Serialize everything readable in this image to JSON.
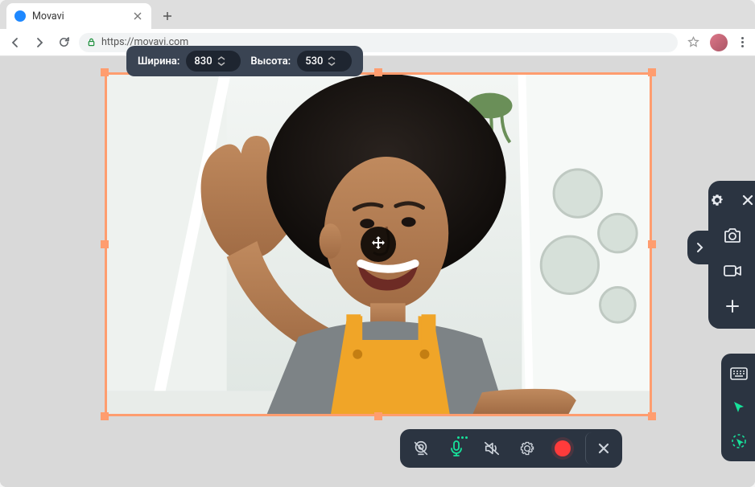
{
  "browser": {
    "tab_title": "Movavi",
    "url": "https://movavi.com"
  },
  "capture": {
    "width_label": "Ширина:",
    "height_label": "Высота:",
    "width_value": "830",
    "height_value": "530"
  },
  "icons": {
    "settings": "gear-icon",
    "close": "close-icon",
    "camera": "camera-icon",
    "video": "video-camera-icon",
    "plus": "plus-icon",
    "expand": "chevron-right-icon",
    "keyboard": "keyboard-icon",
    "cursor": "cursor-icon",
    "cursor_click": "cursor-click-icon",
    "webcam": "webcam-off-icon",
    "mic": "microphone-icon",
    "speaker": "speaker-off-icon",
    "record": "record-icon",
    "cancel": "close-icon",
    "move": "move-icon"
  },
  "colors": {
    "accent_orange": "#ff9d6f",
    "panel_dark": "#2b3441",
    "active_green": "#17e19a",
    "record_red": "#ff3b3b"
  }
}
